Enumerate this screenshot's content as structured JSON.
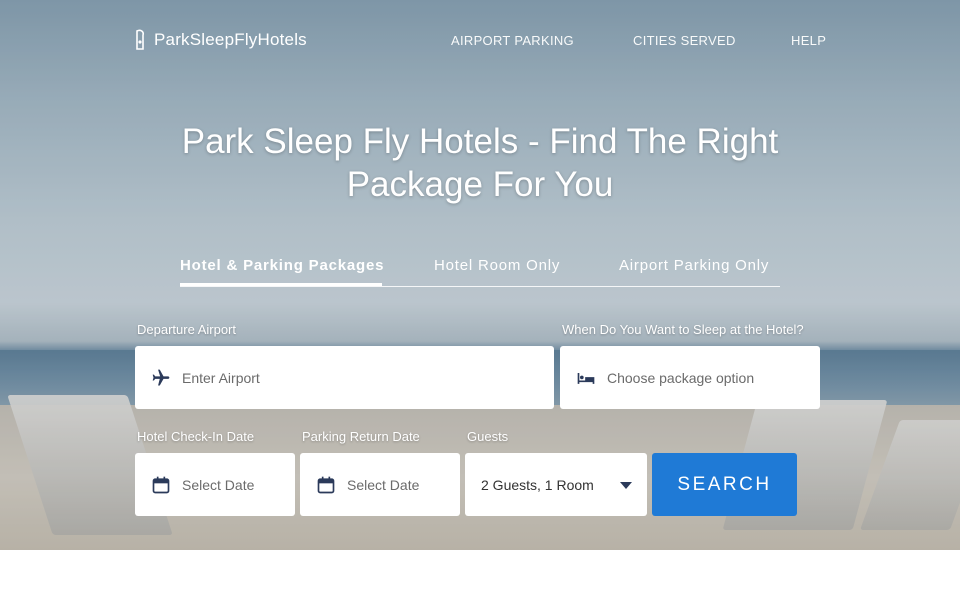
{
  "brand": {
    "name": "ParkSleepFlyHotels"
  },
  "nav": {
    "links": [
      "AIRPORT PARKING",
      "CITIES SERVED",
      "HELP"
    ]
  },
  "hero": {
    "headline": "Park Sleep Fly Hotels - Find The Right Package For You"
  },
  "tabs": [
    {
      "label": "Hotel & Parking Packages",
      "active": true
    },
    {
      "label": "Hotel Room Only",
      "active": false
    },
    {
      "label": "Airport Parking Only",
      "active": false
    }
  ],
  "form": {
    "departure": {
      "label": "Departure Airport",
      "placeholder": "Enter Airport",
      "icon": "airplane-icon"
    },
    "package": {
      "label": "When Do You Want to Sleep at the Hotel?",
      "placeholder": "Choose package option",
      "icon": "bed-icon"
    },
    "checkin": {
      "label": "Hotel Check-In Date",
      "placeholder": "Select Date",
      "icon": "calendar-icon"
    },
    "parking_return": {
      "label": "Parking Return Date",
      "placeholder": "Select Date",
      "icon": "calendar-icon"
    },
    "guests": {
      "label": "Guests",
      "value": "2 Guests, 1 Room"
    },
    "search_label": "SEARCH"
  },
  "colors": {
    "accent": "#1f7ad6",
    "icon": "#2b3a5a"
  }
}
